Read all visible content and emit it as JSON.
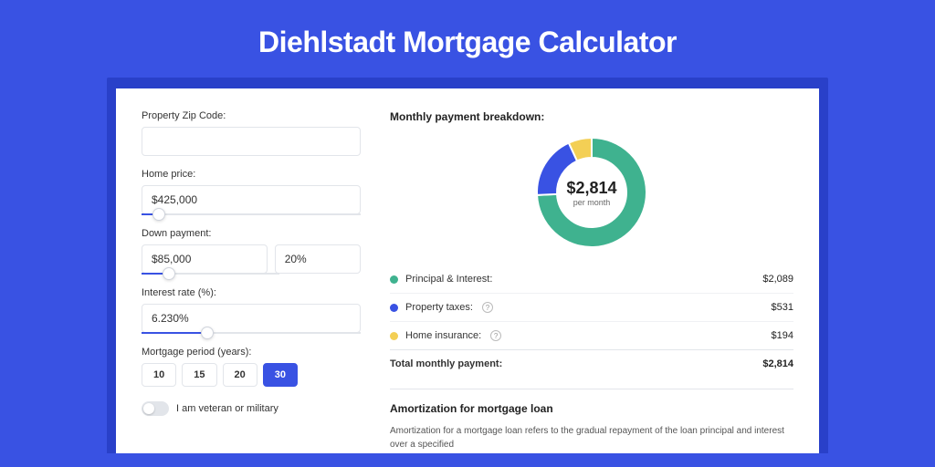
{
  "page": {
    "title": "Diehlstadt Mortgage Calculator"
  },
  "form": {
    "zip": {
      "label": "Property Zip Code:",
      "value": ""
    },
    "home_price": {
      "label": "Home price:",
      "value": "$425,000",
      "slider_pct": 8
    },
    "down_payment": {
      "label": "Down payment:",
      "amount": "$85,000",
      "percent": "20%",
      "slider_pct": 20
    },
    "interest_rate": {
      "label": "Interest rate (%):",
      "value": "6.230%",
      "slider_pct": 30
    },
    "period": {
      "label": "Mortgage period (years):",
      "options": [
        "10",
        "15",
        "20",
        "30"
      ],
      "selected": "30"
    },
    "veteran": {
      "label": "I am veteran or military",
      "on": false
    }
  },
  "breakdown": {
    "title": "Monthly payment breakdown:",
    "center_amount": "$2,814",
    "center_sub": "per month",
    "items": [
      {
        "label": "Principal & Interest:",
        "value": "$2,089",
        "color": "#3fb28f",
        "help": false
      },
      {
        "label": "Property taxes:",
        "value": "$531",
        "color": "#3952e3",
        "help": true
      },
      {
        "label": "Home insurance:",
        "value": "$194",
        "color": "#f3cf55",
        "help": true
      }
    ],
    "total": {
      "label": "Total monthly payment:",
      "value": "$2,814"
    }
  },
  "amortization": {
    "title": "Amortization for mortgage loan",
    "text": "Amortization for a mortgage loan refers to the gradual repayment of the loan principal and interest over a specified"
  },
  "chart_data": {
    "type": "pie",
    "title": "Monthly payment breakdown",
    "series": [
      {
        "name": "Principal & Interest",
        "value": 2089,
        "color": "#3fb28f"
      },
      {
        "name": "Property taxes",
        "value": 531,
        "color": "#3952e3"
      },
      {
        "name": "Home insurance",
        "value": 194,
        "color": "#f3cf55"
      }
    ],
    "total": 2814,
    "center_label": "$2,814 per month"
  }
}
